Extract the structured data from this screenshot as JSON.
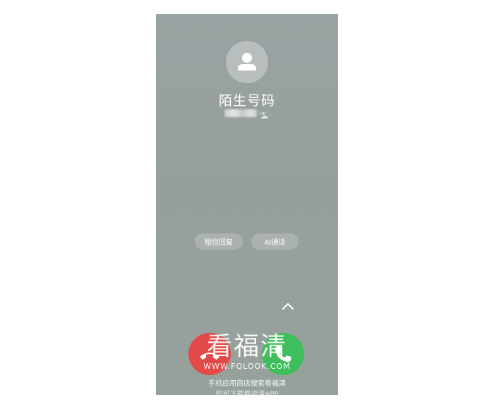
{
  "caller": {
    "name": "陌生号码",
    "hd_badge": "HD"
  },
  "quick_actions": {
    "sms_reply": "短信回复",
    "ai_call": "AI通话"
  },
  "watermark": {
    "logo": "看福清",
    "url": "WWW.FQLOOK.COM",
    "hint_line1": "手机应用商店搜索看福清",
    "hint_line2": "即可下载看福清APP"
  },
  "colors": {
    "decline": "#e14a49",
    "accept": "#3fbe5b",
    "background": "#9aa3a3"
  },
  "icons": {
    "avatar": "person-icon",
    "hd": "hd-signal-icon",
    "swipe": "chevron-up-icon",
    "decline": "phone-hangup-icon",
    "accept": "phone-answer-icon"
  }
}
